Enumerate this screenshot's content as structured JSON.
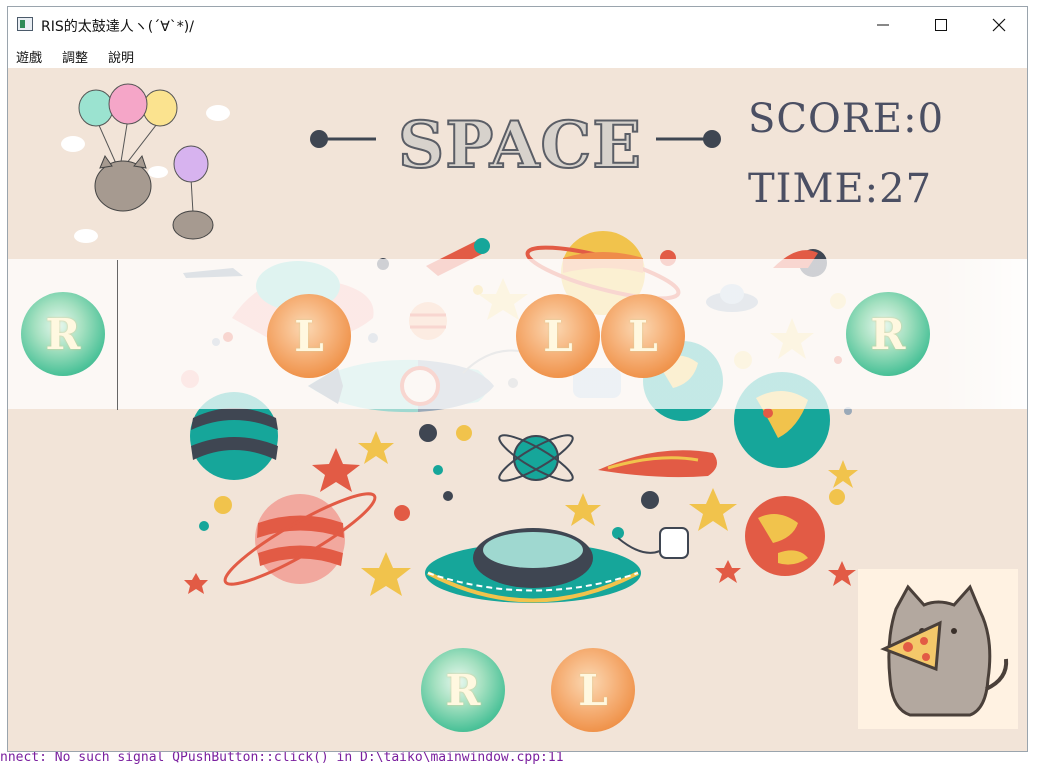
{
  "window": {
    "title": "RIS的太鼓達人ヽ(´∀`*)/"
  },
  "menu": [
    "遊戲",
    "調整",
    "說明"
  ],
  "hud": {
    "title": "SPACE",
    "score": "SCORE:0",
    "time": "TIME:27"
  },
  "lane_notes": [
    {
      "type": "r",
      "label": "R"
    },
    {
      "type": "l",
      "label": "L"
    },
    {
      "type": "l",
      "label": "L"
    },
    {
      "type": "l",
      "label": "L"
    },
    {
      "type": "r",
      "label": "R"
    }
  ],
  "drum_buttons": [
    {
      "type": "r",
      "label": "R"
    },
    {
      "type": "l",
      "label": "L"
    }
  ],
  "background_code": "nnect: No such signal QPushButton::click() in D:\\taiko\\mainwindow.cpp:11"
}
